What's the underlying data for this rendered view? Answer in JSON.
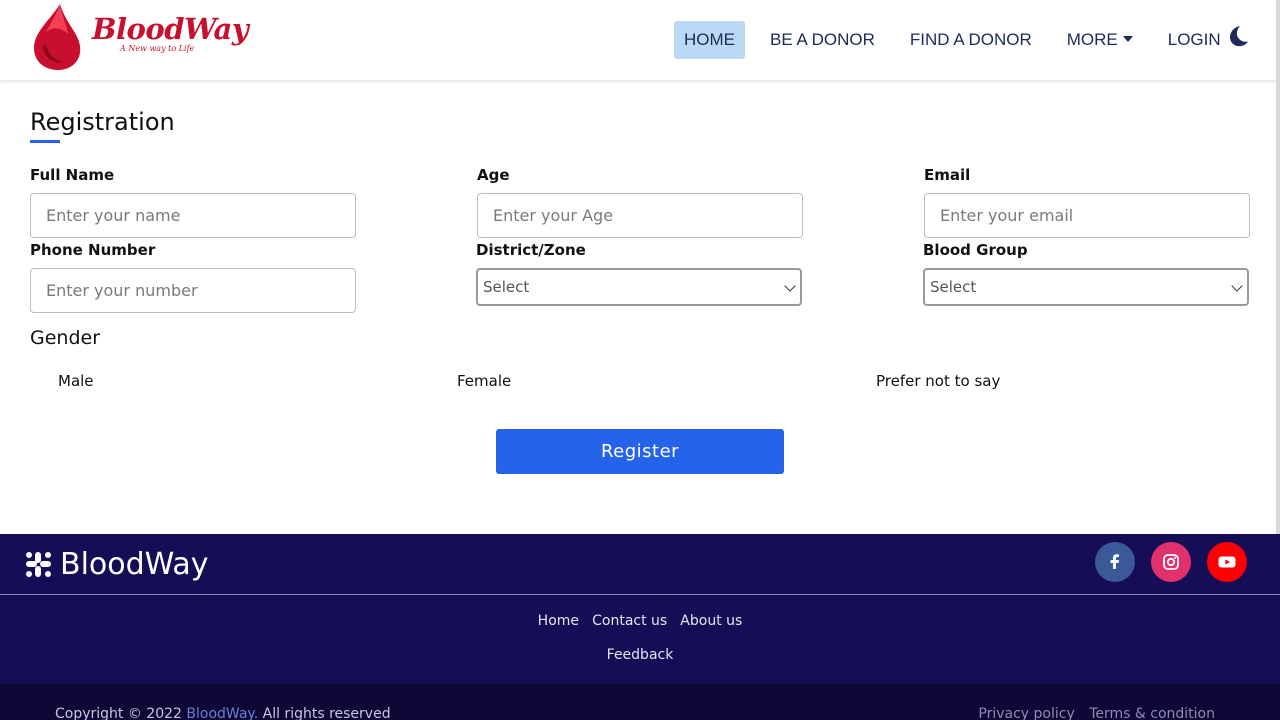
{
  "brand": {
    "name": "BloodWay",
    "tagline": "A New way to Life",
    "color": "#c8102e"
  },
  "nav": {
    "items": [
      {
        "label": "HOME",
        "active": true
      },
      {
        "label": "BE A DONOR",
        "active": false
      },
      {
        "label": "FIND A DONOR",
        "active": false
      },
      {
        "label": "MORE",
        "active": false
      },
      {
        "label": "LOGIN",
        "active": false
      }
    ],
    "theme_toggle_icon": "moon-icon"
  },
  "form": {
    "title": "Registration",
    "fields": {
      "full_name": {
        "label": "Full Name",
        "placeholder": "Enter your name"
      },
      "age": {
        "label": "Age",
        "placeholder": "Enter your Age"
      },
      "email": {
        "label": "Email",
        "placeholder": "Enter your email"
      },
      "phone": {
        "label": "Phone Number",
        "placeholder": "Enter your number"
      },
      "district": {
        "label": "District/Zone",
        "value": "Select"
      },
      "blood_group": {
        "label": "Blood Group",
        "value": "Select"
      }
    },
    "gender": {
      "title": "Gender",
      "options": [
        "Male",
        "Female",
        "Prefer not to say"
      ]
    },
    "submit_label": "Register",
    "accent": "#2563eb"
  },
  "footer": {
    "brand": "BloodWay",
    "social": [
      "facebook-icon",
      "instagram-icon",
      "youtube-icon"
    ],
    "links": [
      "Home",
      "Contact us",
      "About us"
    ],
    "feedback": "Feedback",
    "background": "#150d55",
    "copyright_prefix": "Copyright © 2022",
    "copyright_brand": "BloodWay.",
    "copyright_suffix": "All rights reserved",
    "bottom_links": [
      "Privacy policy",
      "Terms & condition"
    ]
  }
}
